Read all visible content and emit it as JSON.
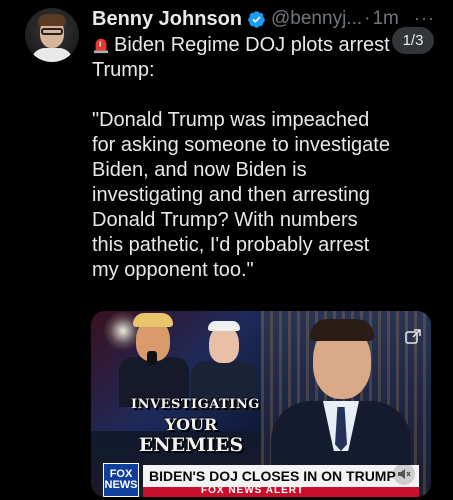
{
  "post": {
    "author_name": "Benny Johnson",
    "handle": "@bennyj...",
    "separator": "·",
    "time": "1m",
    "more": "···",
    "image_counter": "1/3",
    "text_first_line": "Biden Regime DOJ plots arrest Trump:",
    "text_body": "\"Donald Trump was impeached for asking someone to investigate Biden, and now Biden is investigating and then arresting Donald Trump? With numbers this pathetic, I'd probably arrest my opponent too.\""
  },
  "media": {
    "graphic_line1": "INVESTIGATING",
    "graphic_line2": "YOUR",
    "graphic_line3": "ENEMIES",
    "network_logo_top": "FOX",
    "network_logo_bottom": "NEWS",
    "headline": "BIDEN'S DOJ CLOSES IN ON TRUMP",
    "alert": "FOX NEWS ALERT"
  },
  "colors": {
    "background": "#000000",
    "text": "#e7e9ea",
    "secondary": "#71767b",
    "verified": "#1d9bf0"
  }
}
